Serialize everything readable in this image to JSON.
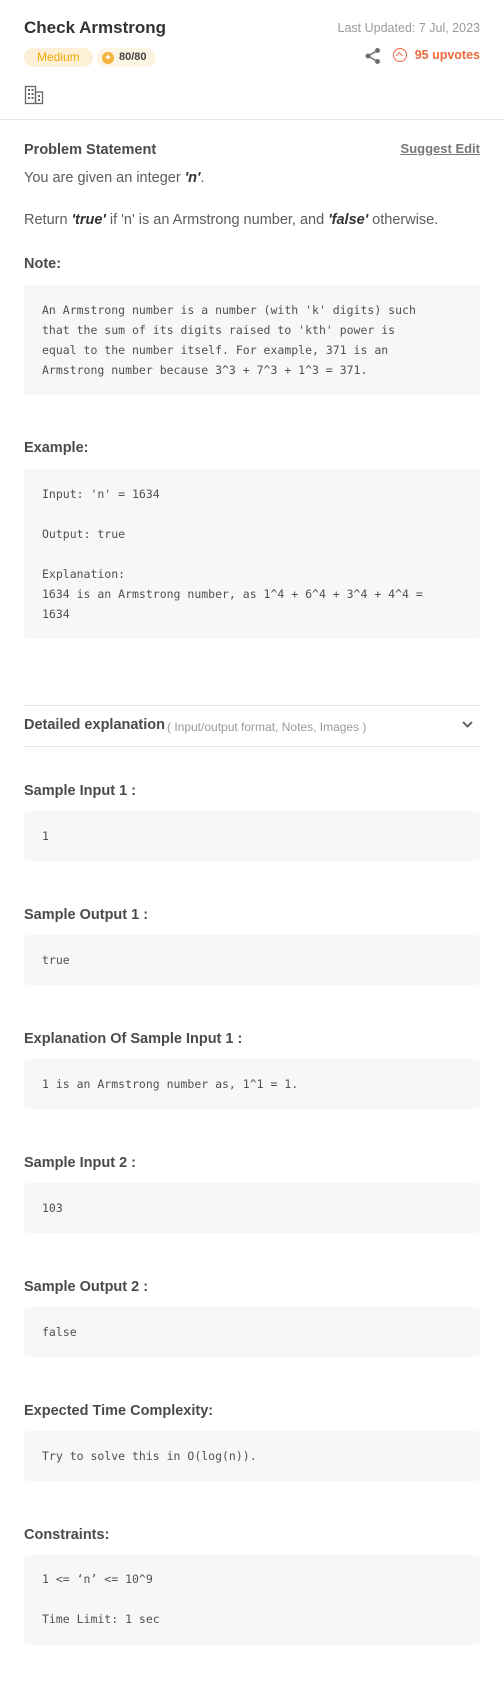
{
  "header": {
    "title": "Check Armstrong",
    "last_updated": "Last Updated: 7 Jul, 2023",
    "difficulty": "Medium",
    "score": "80/80",
    "upvotes": "95 upvotes",
    "icons": [
      "share-icon",
      "upvote-icon",
      "company-icon",
      "coin-icon"
    ]
  },
  "problem": {
    "heading": "Problem Statement",
    "suggest_edit": "Suggest Edit",
    "line1_prefix": "You are given an integer ",
    "line1_var": "'n'",
    "line1_suffix": ".",
    "line2_prefix": "Return ",
    "line2_true": "'true'",
    "line2_mid": " if 'n' is an Armstrong number, and ",
    "line2_false": "'false'",
    "line2_suffix": " otherwise."
  },
  "note": {
    "heading": "Note:",
    "code": "An Armstrong number is a number (with 'k' digits) such\nthat the sum of its digits raised to 'kth' power is\nequal to the number itself. For example, 371 is an\nArmstrong number because 3^3 + 7^3 + 1^3 = 371."
  },
  "example": {
    "heading": "Example:",
    "code": "Input: 'n' = 1634\n\nOutput: true\n\nExplanation:\n1634 is an Armstrong number, as 1^4 + 6^4 + 3^4 + 4^4 =\n1634"
  },
  "detailed": {
    "label": "Detailed explanation",
    "sub": "( Input/output format, Notes, Images )"
  },
  "sections": [
    {
      "heading": "Sample Input 1 :",
      "code": "1"
    },
    {
      "heading": "Sample Output 1 :",
      "code": "true"
    },
    {
      "heading": "Explanation Of Sample Input 1 :",
      "code": "1 is an Armstrong number as, 1^1 = 1."
    },
    {
      "heading": "Sample Input 2 :",
      "code": "103"
    },
    {
      "heading": "Sample Output 2 :",
      "code": "false"
    },
    {
      "heading": "Expected Time Complexity:",
      "code": "Try to solve this in O(log(n))."
    },
    {
      "heading": "Constraints:",
      "code": "1 <= ‘n’ <= 10^9\n\nTime Limit: 1 sec"
    }
  ],
  "colors": {
    "accent_upvote": "#ed6a3c",
    "difficulty_text": "#f0a800",
    "difficulty_bg": "#fdf0d7",
    "code_bg": "#f7f7f7"
  }
}
